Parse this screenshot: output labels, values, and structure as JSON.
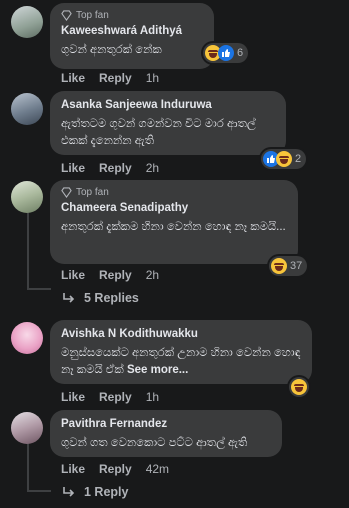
{
  "comments": [
    {
      "badge": "Top fan",
      "author": "Kaweeshwará Adithyá",
      "body": "ගුවන් අනතුරක් නේක",
      "actions": {
        "like": "Like",
        "reply": "Reply",
        "time": "1h"
      },
      "reactions": {
        "count": "6",
        "types": [
          "laugh",
          "like"
        ]
      },
      "avatar_colors": [
        "#cfd6d8",
        "#6d7d72"
      ]
    },
    {
      "author": "Asanka Sanjeewa Induruwa",
      "body": "ඇත්තටම ගුවන් ගමන්වන විට මාර ආතල් එකක් දැනෙන්න ඇති",
      "actions": {
        "like": "Like",
        "reply": "Reply",
        "time": "2h"
      },
      "reactions": {
        "count": "2",
        "types": [
          "like",
          "laugh"
        ]
      },
      "avatar_colors": [
        "#b9c3cf",
        "#4a5868"
      ]
    },
    {
      "badge": "Top fan",
      "author": "Chameera Senadipathy",
      "body": "අනතුරක් දැක්කම හිනා වෙන්න හොඳ නෑ කමයි...",
      "actions": {
        "like": "Like",
        "reply": "Reply",
        "time": "2h"
      },
      "reactions": {
        "count": "37",
        "types": [
          "laugh"
        ]
      },
      "replies": "5 Replies",
      "avatar_colors": [
        "#c9d3c2",
        "#7c8f72"
      ]
    },
    {
      "author": "Avishka N Kodithuwakku",
      "body": "මනුස්සයෙක්ට අනතුරක් උනාම හිනා වෙන්න හොඳ නෑ කමයි ඒක්",
      "see_more": "See more...",
      "actions": {
        "like": "Like",
        "reply": "Reply",
        "time": "1h"
      },
      "reactions": {
        "types": [
          "laugh"
        ]
      },
      "avatar_colors": [
        "#f2c6dc",
        "#e07fb0"
      ]
    },
    {
      "author": "Pavithra Fernandez",
      "body": "ගුවන් ගත වෙනකොට පට්ට ආතල් ඇති",
      "actions": {
        "like": "Like",
        "reply": "Reply",
        "time": "42m"
      },
      "replies": "1 Reply",
      "avatar_colors": [
        "#d9d4da",
        "#8a6a78"
      ]
    }
  ],
  "colors": {
    "background": "#18191a",
    "bubble": "#3a3b3c",
    "muted": "#b0b3b8",
    "like_blue": "#1b74e4",
    "emoji_yellow": "#f7c43a"
  }
}
